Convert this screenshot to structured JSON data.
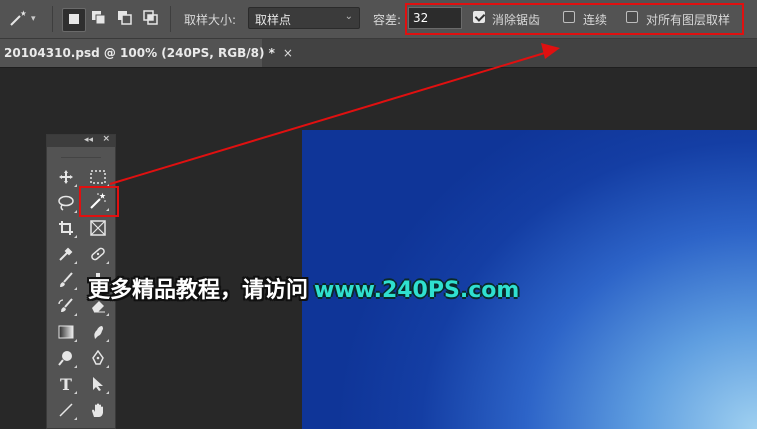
{
  "options_bar": {
    "tool_preset_icon": "magic-wand-icon",
    "selection_modes": [
      "new-selection-icon",
      "add-to-selection-icon",
      "subtract-from-selection-icon",
      "intersect-selection-icon"
    ],
    "sample_size_label": "取样大小:",
    "sample_size_value": "取样点",
    "tolerance_label": "容差:",
    "tolerance_value": "32",
    "anti_alias_label": "消除锯齿",
    "anti_alias_checked": true,
    "contiguous_label": "连续",
    "contiguous_checked": false,
    "sample_all_layers_label": "对所有图层取样",
    "sample_all_layers_checked": false
  },
  "document_tab": {
    "title": "20104310.psd @ 100% (240PS, RGB/8) *",
    "close_glyph": "×"
  },
  "tools_panel": {
    "collapse_glyph": "◂◂",
    "close_glyph": "×",
    "tools": [
      [
        "move-tool-icon",
        "marquee-tool-icon"
      ],
      [
        "lasso-tool-icon",
        "magic-wand-tool-icon"
      ],
      [
        "crop-tool-icon",
        "frame-tool-icon"
      ],
      [
        "eyedropper-tool-icon",
        "healing-brush-tool-icon"
      ],
      [
        "brush-tool-icon",
        "clone-stamp-tool-icon"
      ],
      [
        "history-brush-tool-icon",
        "eraser-tool-icon"
      ],
      [
        "gradient-tool-icon",
        "smudge-tool-icon"
      ],
      [
        "dodge-tool-icon",
        "pen-tool-icon"
      ],
      [
        "type-tool-icon",
        "path-selection-tool-icon"
      ],
      [
        "line-tool-icon",
        "hand-tool-icon"
      ]
    ],
    "type_glyph": "T"
  },
  "watermark": {
    "text_cn": "更多精品教程，请访问",
    "url": "www.240PS.com"
  },
  "colors": {
    "highlight_red": "#e01010",
    "watermark_url": "#2fe0d0"
  }
}
